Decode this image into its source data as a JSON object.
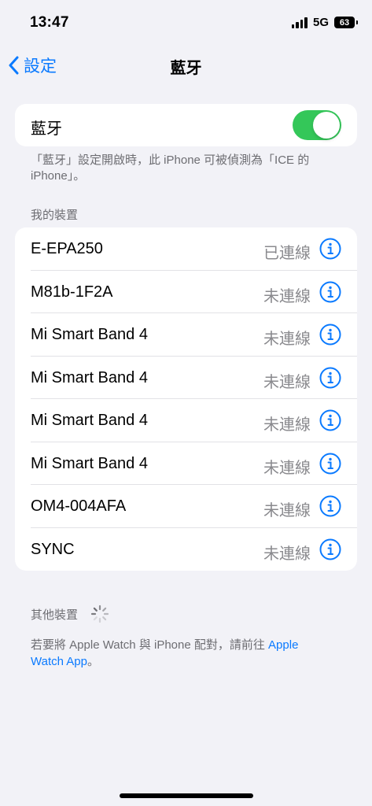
{
  "status_bar": {
    "time": "13:47",
    "network": "5G",
    "battery": "63"
  },
  "nav": {
    "back_label": "設定",
    "title": "藍牙"
  },
  "bluetooth": {
    "label": "藍牙",
    "enabled": true,
    "footnote": "「藍牙」設定開啟時，此 iPhone 可被偵測為「ICE 的 iPhone」。"
  },
  "my_devices": {
    "header": "我的裝置",
    "items": [
      {
        "name": "E-EPA250",
        "status": "已連線"
      },
      {
        "name": "M81b-1F2A",
        "status": "未連線"
      },
      {
        "name": "Mi Smart Band 4",
        "status": "未連線"
      },
      {
        "name": "Mi Smart Band 4",
        "status": "未連線"
      },
      {
        "name": "Mi Smart Band 4",
        "status": "未連線"
      },
      {
        "name": "Mi Smart Band 4",
        "status": "未連線"
      },
      {
        "name": "OM4-004AFA",
        "status": "未連線"
      },
      {
        "name": "SYNC",
        "status": "未連線"
      }
    ]
  },
  "other_devices": {
    "header": "其他裝置",
    "note_text": "若要將 Apple Watch 與 iPhone 配對，請前往",
    "note_link": "Apple Watch App",
    "note_end": "。"
  },
  "colors": {
    "accent": "#0a7aff",
    "toggle_on": "#34c759",
    "background": "#f2f2f7"
  }
}
